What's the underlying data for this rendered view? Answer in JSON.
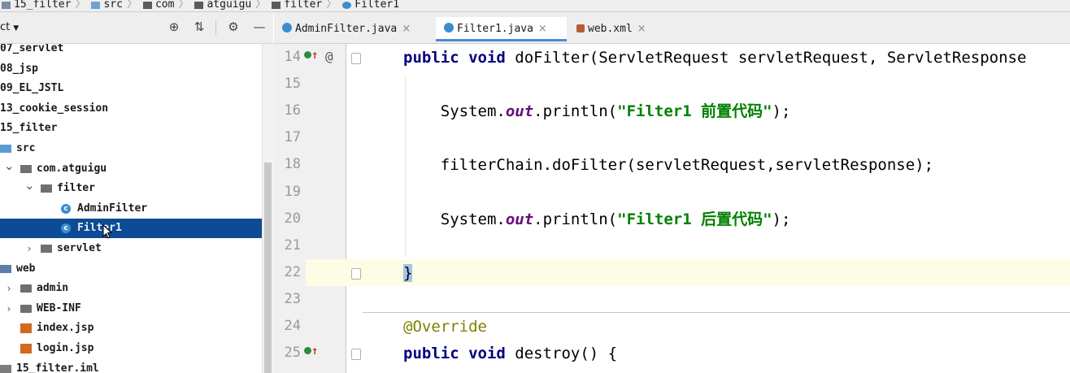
{
  "breadcrumb": [
    "15_filter",
    "src",
    "com",
    "atguigu",
    "filter",
    "Filter1"
  ],
  "project": {
    "title": "ct",
    "tree": [
      {
        "label": "07_servlet",
        "indent": 0,
        "arrow": "",
        "icon": "none"
      },
      {
        "label": "08_jsp",
        "indent": 0,
        "arrow": "",
        "icon": "none"
      },
      {
        "label": "09_EL_JSTL",
        "indent": 0,
        "arrow": "",
        "icon": "none"
      },
      {
        "label": "13_cookie_session",
        "indent": 0,
        "arrow": "",
        "icon": "none"
      },
      {
        "label": "15_filter",
        "indent": 0,
        "arrow": "",
        "icon": "none"
      },
      {
        "label": "src",
        "indent": 0,
        "arrow": "",
        "icon": "folder-blue"
      },
      {
        "label": "com.atguigu",
        "indent": 1,
        "arrow": "v",
        "icon": "pkg"
      },
      {
        "label": "filter",
        "indent": 2,
        "arrow": "v",
        "icon": "pkg"
      },
      {
        "label": "AdminFilter",
        "indent": 3,
        "arrow": "",
        "icon": "cls"
      },
      {
        "label": "Filter1",
        "indent": 3,
        "arrow": "",
        "icon": "cls",
        "selected": true
      },
      {
        "label": "servlet",
        "indent": 2,
        "arrow": ">",
        "icon": "pkg"
      },
      {
        "label": "web",
        "indent": 0,
        "arrow": "",
        "icon": "web"
      },
      {
        "label": "admin",
        "indent": 1,
        "arrow": ">",
        "icon": "folder"
      },
      {
        "label": "WEB-INF",
        "indent": 1,
        "arrow": ">",
        "icon": "folder"
      },
      {
        "label": "index.jsp",
        "indent": 1,
        "arrow": "",
        "icon": "jsp"
      },
      {
        "label": "login.jsp",
        "indent": 1,
        "arrow": "",
        "icon": "jsp"
      },
      {
        "label": "15_filter.iml",
        "indent": 0,
        "arrow": "",
        "icon": "iml"
      }
    ]
  },
  "tabs": [
    {
      "label": "AdminFilter.java",
      "icon": "class",
      "active": false
    },
    {
      "label": "Filter1.java",
      "icon": "class",
      "active": true
    },
    {
      "label": "web.xml",
      "icon": "xml",
      "active": false
    }
  ],
  "editor": {
    "lines": [
      {
        "num": "14",
        "markers": [
          "override-up",
          "at"
        ],
        "tokens": [
          {
            "t": "public void ",
            "c": "kw"
          },
          {
            "t": "doFilter(ServletRequest servletRequest, ServletResponse",
            "c": ""
          }
        ]
      },
      {
        "num": "15",
        "markers": [],
        "tokens": []
      },
      {
        "num": "16",
        "markers": [],
        "tokens": [
          {
            "t": "    System.",
            "c": ""
          },
          {
            "t": "out",
            "c": "fld"
          },
          {
            "t": ".println(",
            "c": ""
          },
          {
            "t": "\"Filter1 前置代码\"",
            "c": "str"
          },
          {
            "t": ");",
            "c": ""
          }
        ]
      },
      {
        "num": "17",
        "markers": [],
        "tokens": []
      },
      {
        "num": "18",
        "markers": [],
        "tokens": [
          {
            "t": "    filterChain.doFilter(servletRequest,servletResponse);",
            "c": ""
          }
        ]
      },
      {
        "num": "19",
        "markers": [],
        "tokens": []
      },
      {
        "num": "20",
        "markers": [],
        "tokens": [
          {
            "t": "    System.",
            "c": ""
          },
          {
            "t": "out",
            "c": "fld"
          },
          {
            "t": ".println(",
            "c": ""
          },
          {
            "t": "\"Filter1 后置代码\"",
            "c": "str"
          },
          {
            "t": ");",
            "c": ""
          }
        ]
      },
      {
        "num": "21",
        "markers": [],
        "tokens": []
      },
      {
        "num": "22",
        "markers": [],
        "tokens": [
          {
            "t": "}",
            "c": "brace"
          }
        ]
      },
      {
        "num": "23",
        "markers": [],
        "tokens": []
      },
      {
        "num": "24",
        "markers": [],
        "tokens": [
          {
            "t": "@Override",
            "c": "ann"
          }
        ]
      },
      {
        "num": "25",
        "markers": [
          "override-up"
        ],
        "tokens": [
          {
            "t": "public void ",
            "c": "kw"
          },
          {
            "t": "destroy() {",
            "c": ""
          }
        ]
      }
    ]
  },
  "colors": {
    "selection": "#0d4c94",
    "keyword": "#000080",
    "string": "#008000",
    "annotation": "#808000"
  }
}
